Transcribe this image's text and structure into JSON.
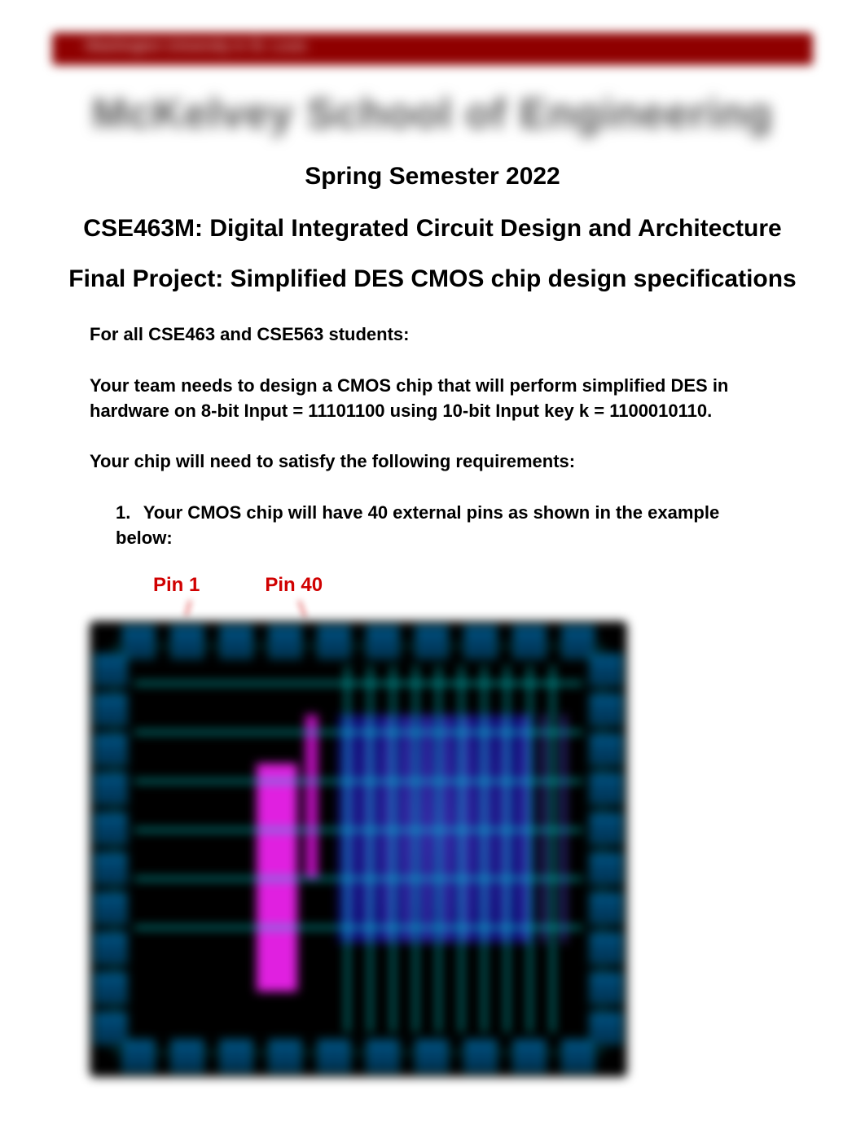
{
  "header": {
    "bar_text": "Washington University in St. Louis",
    "school_title": "McKelvey School of Engineering"
  },
  "titles": {
    "semester": "Spring Semester 2022",
    "course": "CSE463M: Digital Integrated Circuit Design and Architecture",
    "project": "Final Project: Simplified DES CMOS chip design specifications"
  },
  "body": {
    "audience": "For all CSE463 and CSE563 students:",
    "design_task": "Your team needs to design a CMOS chip that will perform simplified DES in hardware on 8-bit Input = 11101100 using 10-bit Input key k = 1100010110.",
    "requirements_intro": "Your chip will need to satisfy the following requirements:",
    "req1_num": "1.",
    "req1_text": "Your CMOS chip will have 40 external pins as shown in the example below:"
  },
  "figure": {
    "pin1_label": "Pin 1",
    "pin40_label": "Pin 40"
  }
}
